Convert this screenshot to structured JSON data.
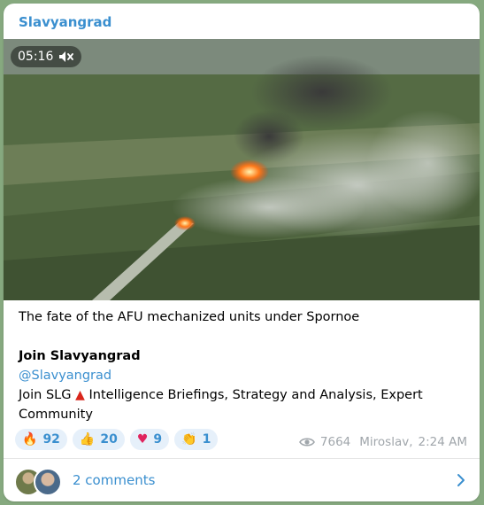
{
  "channel": {
    "name": "Slavyangrad"
  },
  "video": {
    "duration": "05:16",
    "muted_icon": "speaker-muted-icon"
  },
  "post": {
    "line1": "The fate of the AFU mechanized units under Spornoe",
    "join_title": "Join Slavyangrad",
    "handle": "@Slavyangrad",
    "join_prefix": "Join SLG",
    "flag_icon": "red-triangle-icon",
    "join_suffix": "Intelligence Briefings, Strategy and Analysis, Expert",
    "join_suffix2": "Community"
  },
  "reactions": [
    {
      "emoji": "🔥",
      "count": "92",
      "icon": "fire-icon"
    },
    {
      "emoji": "👍",
      "count": "20",
      "icon": "thumbs-up-icon"
    },
    {
      "emoji": "♥",
      "count": "9",
      "icon": "heart-icon"
    },
    {
      "emoji": "👏",
      "count": "1",
      "icon": "clap-icon"
    }
  ],
  "meta": {
    "views": "7664",
    "author": "Miroslav,",
    "time": "2:24 AM"
  },
  "comments": {
    "label": "2 comments"
  },
  "colors": {
    "accent": "#3a8fcf",
    "reaction_bg": "#e6f0fa",
    "meta": "#a0a6ab"
  }
}
